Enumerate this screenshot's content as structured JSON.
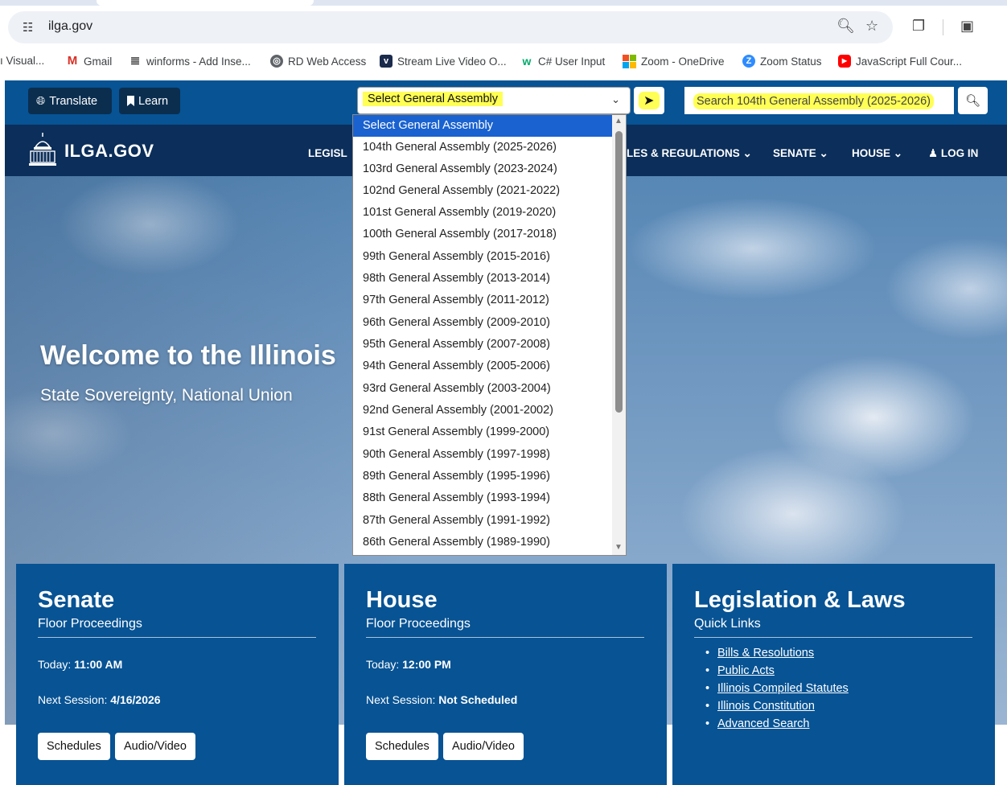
{
  "browser": {
    "url": "ilga.gov",
    "bookmarks": [
      {
        "label": "ı Visual..."
      },
      {
        "label": "Gmail",
        "icon": "gmail-icon",
        "color": "#d93025"
      },
      {
        "label": "winforms - Add Inse...",
        "icon": "stackoverflow-icon",
        "color": "#333333"
      },
      {
        "label": "RD Web Access",
        "icon": "globe-icon",
        "color": "#5f6368"
      },
      {
        "label": "Stream Live Video O...",
        "icon": "vimeo-icon",
        "color": "#1a2b4c"
      },
      {
        "label": "C# User Input",
        "icon": "w3schools-icon",
        "color": "#04aa6d"
      },
      {
        "label": "Zoom - OneDrive",
        "icon": "microsoft-icon",
        "color": "#f25022"
      },
      {
        "label": "Zoom Status",
        "icon": "zoom-icon",
        "color": "#2d8cff"
      },
      {
        "label": "JavaScript Full Cour...",
        "icon": "youtube-icon",
        "color": "#ff0000"
      }
    ]
  },
  "utility": {
    "translate_label": "Translate",
    "learn_label": "Learn",
    "select_label": "Select General Assembly",
    "search_placeholder": "Search 104th General Assembly (2025-2026)"
  },
  "nav": {
    "logo_text": "ILGA.GOV",
    "items": [
      "LEGISL",
      "LES & REGULATIONS ⌄",
      "SENATE ⌄",
      "HOUSE ⌄",
      "LOG IN"
    ]
  },
  "hero": {
    "title": "Welcome to the Illinois",
    "subtitle": "State Sovereignty, National Union"
  },
  "dropdown": {
    "options": [
      "Select General Assembly",
      "104th General Assembly (2025-2026)",
      "103rd General Assembly (2023-2024)",
      "102nd General Assembly (2021-2022)",
      "101st General Assembly (2019-2020)",
      "100th General Assembly (2017-2018)",
      "99th General Assembly (2015-2016)",
      "98th General Assembly (2013-2014)",
      "97th General Assembly (2011-2012)",
      "96th General Assembly (2009-2010)",
      "95th General Assembly (2007-2008)",
      "94th General Assembly (2005-2006)",
      "93rd General Assembly (2003-2004)",
      "92nd General Assembly (2001-2002)",
      "91st General Assembly (1999-2000)",
      "90th General Assembly (1997-1998)",
      "89th General Assembly (1995-1996)",
      "88th General Assembly (1993-1994)",
      "87th General Assembly (1991-1992)",
      "86th General Assembly (1989-1990)"
    ]
  },
  "cards": {
    "senate": {
      "title": "Senate",
      "subtitle": "Floor Proceedings",
      "today_label": "Today:",
      "today_value": "11:00 AM",
      "next_label": "Next Session:",
      "next_value": "4/16/2026",
      "btn1": "Schedules",
      "btn2": "Audio/Video"
    },
    "house": {
      "title": "House",
      "subtitle": "Floor Proceedings",
      "today_label": "Today:",
      "today_value": "12:00 PM",
      "next_label": "Next Session:",
      "next_value": "Not Scheduled",
      "btn1": "Schedules",
      "btn2": "Audio/Video"
    },
    "legislation": {
      "title": "Legislation & Laws",
      "subtitle": "Quick Links",
      "links": [
        "Bills & Resolutions",
        "Public Acts",
        "Illinois Compiled Statutes",
        "Illinois Constitution",
        "Advanced Search"
      ]
    }
  },
  "colors": {
    "utility_bar": "#075394",
    "nav_bar": "#0b2e5a",
    "highlight": "#ffff55",
    "selected_option": "#1a62d0"
  }
}
